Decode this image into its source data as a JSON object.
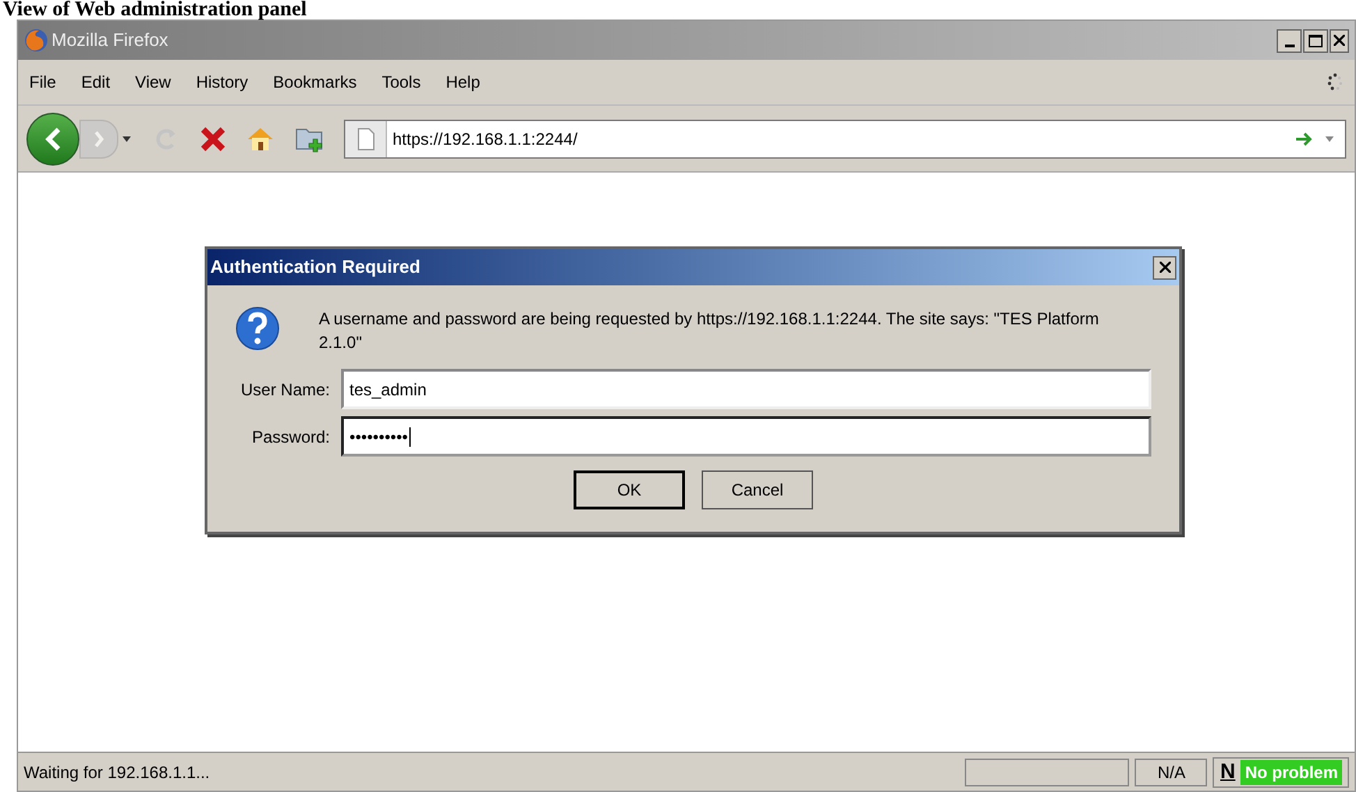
{
  "caption": "View of Web administration panel",
  "window": {
    "title": "Mozilla Firefox"
  },
  "menu": [
    "File",
    "Edit",
    "View",
    "History",
    "Bookmarks",
    "Tools",
    "Help"
  ],
  "toolbar": {
    "address": "https://192.168.1.1:2244/",
    "forward_disabled": true,
    "reload_disabled": true
  },
  "dialog": {
    "title": "Authentication Required",
    "message": "A username and password are being requested by https://192.168.1.1:2244. The site says: \"TES Platform 2.1.0\"",
    "fields": [
      {
        "label": "User Name:",
        "value": "tes_admin",
        "focused": false
      },
      {
        "label": "Password:",
        "value": "••••••••••",
        "focused": true
      }
    ],
    "buttons": [
      {
        "label": "OK",
        "default": true
      },
      {
        "label": "Cancel",
        "default": false
      }
    ]
  },
  "status_bar": {
    "text": "Waiting for 192.168.1.1...",
    "zone": "N/A",
    "badge_letter": "N",
    "badge": "No problem"
  }
}
